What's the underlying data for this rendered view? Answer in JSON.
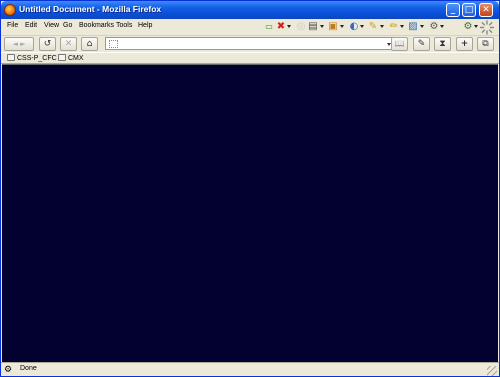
{
  "window": {
    "title": "Untitled Document - Mozilla Firefox",
    "controls": {
      "minimize": "_",
      "maximize": "□",
      "close": "✕"
    }
  },
  "menu": [
    {
      "label": "File"
    },
    {
      "label": "Edit"
    },
    {
      "label": "View"
    },
    {
      "label": "Go"
    },
    {
      "label": "Bookmarks"
    },
    {
      "label": "Tools"
    },
    {
      "label": "Help"
    }
  ],
  "toolbar_icons": [
    "extension-icon",
    "delete-icon",
    "feed-icon",
    "page-icon",
    "folder-icon",
    "paint-icon",
    "plugin-icon",
    "pencil-icon",
    "image-icon",
    "tools-icon",
    "settings-icon",
    "throbber-icon"
  ],
  "navbar": {
    "back_glyph": "◄",
    "forward_glyph": "►",
    "reload_glyph": "↺",
    "stop_glyph": "✕",
    "home_glyph": "⌂",
    "url_value": "",
    "right_glyphs": {
      "book": "📖",
      "edit": "✎",
      "hourglass": "⧗",
      "plus": "+",
      "window": "⧉"
    }
  },
  "bookmarks": [
    {
      "label": "CSS-P_CFC"
    },
    {
      "label": "CMX"
    }
  ],
  "content": {
    "background": "#020130"
  },
  "status": {
    "text": "Done"
  }
}
